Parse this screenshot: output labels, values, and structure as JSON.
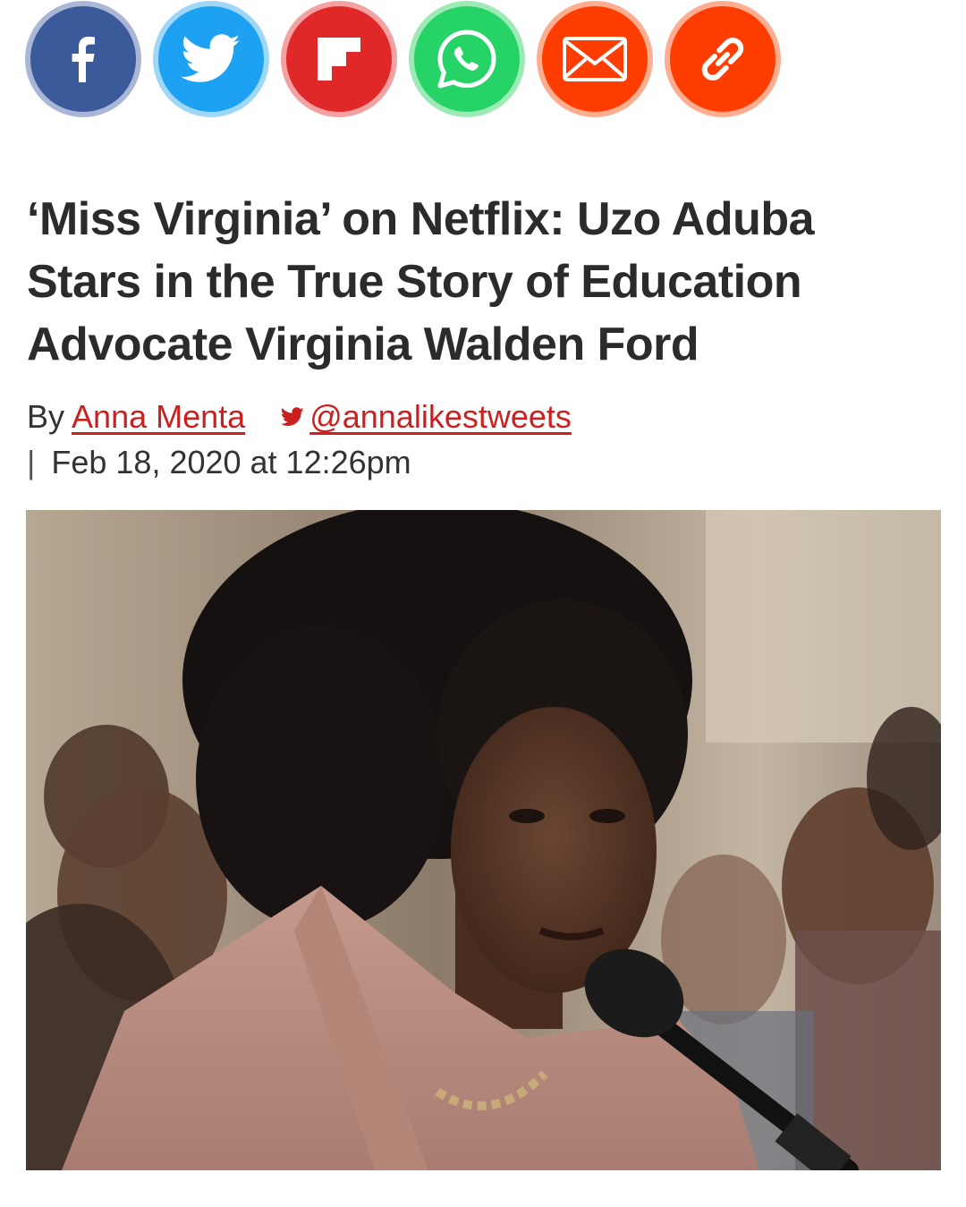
{
  "share": {
    "buttons": [
      {
        "name": "facebook-share-button",
        "icon": "facebook-icon",
        "fill": "#3b5a9a",
        "ring": "#a9b6d6"
      },
      {
        "name": "twitter-share-button",
        "icon": "twitter-icon",
        "fill": "#1da1f2",
        "ring": "#9ed7f7"
      },
      {
        "name": "flipboard-share-button",
        "icon": "flipboard-icon",
        "fill": "#e12828",
        "ring": "#f3a1a1"
      },
      {
        "name": "whatsapp-share-button",
        "icon": "whatsapp-icon",
        "fill": "#25d366",
        "ring": "#9eeab7"
      },
      {
        "name": "email-share-button",
        "icon": "mail-icon",
        "fill": "#ff3d00",
        "ring": "#ffad91"
      },
      {
        "name": "copy-link-button",
        "icon": "link-icon",
        "fill": "#ff3d00",
        "ring": "#ffad91"
      }
    ]
  },
  "article": {
    "title": "‘Miss Virginia’ on Netflix: Uzo Aduba Stars in the True Story of Education Advocate Virginia Walden Ford",
    "by_prefix": "By",
    "author": "Anna Menta",
    "twitter_handle": "@annalikestweets",
    "separator": "|",
    "date": "Feb 18, 2020 at 12:26pm"
  },
  "colors": {
    "link": "#cc1f1f",
    "headline": "#2b2b2b"
  }
}
